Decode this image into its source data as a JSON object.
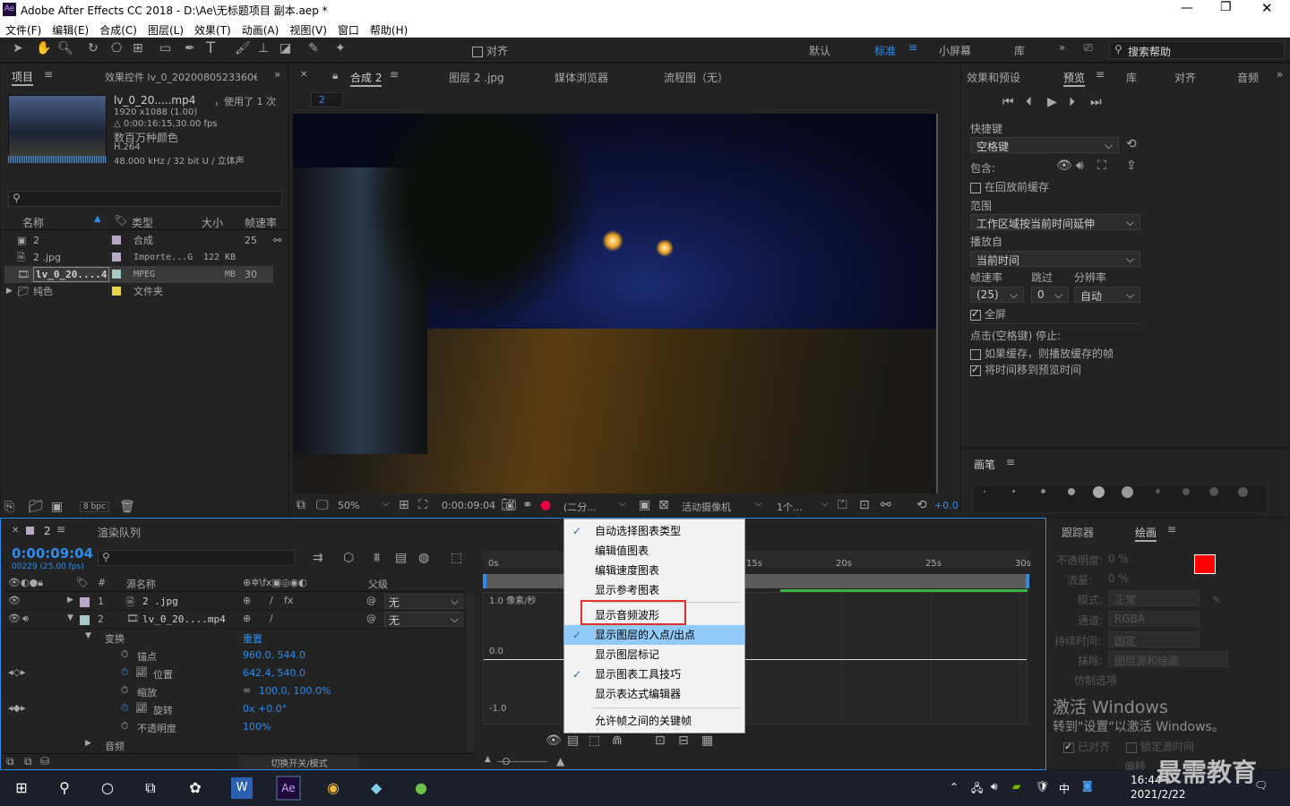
{
  "app": {
    "title": "Adobe After Effects CC 2018 - D:\\Ae\\无标题项目 副本.aep *",
    "logo": "Ae"
  },
  "menus": [
    "文件(F)",
    "编辑(E)",
    "合成(C)",
    "图层(L)",
    "效果(T)",
    "动画(A)",
    "视图(V)",
    "窗口",
    "帮助(H)"
  ],
  "toolbar": {
    "align": "对齐",
    "workspaces": [
      "默认",
      "标准",
      "小屏幕",
      "库"
    ],
    "search": "搜索帮助"
  },
  "project": {
    "tab": "项目",
    "effects_tab": "效果控件 lv_0_2020080523360€",
    "filename": "lv_0_20.....mp4",
    "used": "，使用了 1 次",
    "res": "1920 x1088 (1.00)",
    "dur": "△ 0:00:16:15,30.00 fps",
    "colors": "数百万种颜色",
    "codec": "H.264",
    "audio": "48.000 kHz / 32 bit U / 立体声",
    "cols": [
      "名称",
      "类型",
      "大小",
      "帧速率"
    ],
    "items": [
      {
        "name": "2",
        "type": "合成",
        "size": "",
        "fps": "25",
        "color": "#b9a6c9"
      },
      {
        "name": "2 .jpg",
        "type": "Importe...G",
        "size": "122 KB",
        "fps": "",
        "color": "#b9a6c9"
      },
      {
        "name": "lv_0_20....4",
        "type": "MPEG",
        "size": "MB",
        "fps": "30",
        "color": "#a6c9c9"
      },
      {
        "name": "纯色",
        "type": "文件夹",
        "size": "",
        "fps": "",
        "color": "#e8d44a"
      }
    ],
    "bpc": "8 bpc"
  },
  "viewer": {
    "tab": "合成 2",
    "layer_tab": "图层 2 .jpg",
    "media_tab": "媒体浏览器",
    "flow_tab": "流程图（无）",
    "comp_chip": "2",
    "zoom": "50%",
    "time": "0:00:09:04",
    "res": "(二分...",
    "camera": "活动摄像机",
    "views": "1个...",
    "exposure": "+0.0"
  },
  "preview": {
    "tabs": [
      "效果和预设",
      "预览",
      "库",
      "对齐",
      "音频"
    ],
    "shortcut_label": "快捷键",
    "shortcut": "空格键",
    "include": "包含:",
    "cache": "在回放前缓存",
    "range_label": "范围",
    "range": "工作区域按当前时间延伸",
    "from_label": "播放自",
    "from": "当前时间",
    "fps_label": "帧速率",
    "skip_label": "跳过",
    "res_label": "分辨率",
    "fps": "(25)",
    "skip": "0",
    "res": "自动",
    "fullscreen": "全屏",
    "stop_label": "点击(空格键) 停止:",
    "if_cache": "如果缓存，则播放缓存的帧",
    "move_time": "将时间移到预览时间"
  },
  "brush": {
    "tab": "画笔",
    "sizes": [
      "1",
      "3",
      "5",
      "9",
      "13",
      "19",
      "5",
      "9",
      "13",
      "17"
    ]
  },
  "timeline": {
    "tab": "2",
    "render_tab": "渲染队列",
    "time": "0:00:09:04",
    "frames": "00229 (25.00 fps)",
    "cols": [
      "源名称",
      "父级"
    ],
    "layers": [
      {
        "num": "1",
        "name": "2 .jpg",
        "parent": "无"
      },
      {
        "num": "2",
        "name": "lv_0_20....mp4",
        "parent": "无"
      }
    ],
    "transform": "变换",
    "reset": "重置",
    "props": [
      {
        "name": "锚点",
        "val": "960.0, 544.0"
      },
      {
        "name": "位置",
        "val": "642.4, 540.0"
      },
      {
        "name": "缩放",
        "val": "100.0, 100.0%"
      },
      {
        "name": "旋转",
        "val": "0x +0.0°"
      },
      {
        "name": "不透明度",
        "val": "100%"
      }
    ],
    "audio": "音频",
    "toggle": "切换开关/模式",
    "ruler": [
      "0s",
      "15s",
      "20s",
      "25s",
      "30s"
    ],
    "graph_label": "1.0 像素/秒",
    "graph_mid": "0.0",
    "graph_low": "-1.0"
  },
  "context_menu": {
    "items": [
      {
        "label": "自动选择图表类型",
        "checked": true
      },
      {
        "label": "编辑值图表",
        "checked": false
      },
      {
        "label": "编辑速度图表",
        "checked": false
      },
      {
        "label": "显示参考图表",
        "checked": false
      },
      {
        "label": "显示音频波形",
        "checked": false
      },
      {
        "label": "显示图层的入点/出点",
        "checked": true
      },
      {
        "label": "显示图层标记",
        "checked": false
      },
      {
        "label": "显示图表工具技巧",
        "checked": true
      },
      {
        "label": "显示表达式编辑器",
        "checked": false
      },
      {
        "label": "允许帧之间的关键帧",
        "checked": false
      }
    ]
  },
  "tracker": {
    "tab": "跟踪器",
    "paint_tab": "绘画",
    "opacity": "不透明度:",
    "opacity_val": "0 %",
    "flow": "流量:",
    "flow_val": "0 %",
    "mode": "模式:",
    "mode_val": "正常",
    "channel": "通道:",
    "channel_val": "RGBA",
    "duration": "持续时间:",
    "duration_val": "固定",
    "erase": "抹除:",
    "erase_val": "图层源和绘画",
    "clone": "仿制选项",
    "aligned": "已对齐",
    "lock": "锁定源时间",
    "offset": "偏移"
  },
  "watermark": {
    "line1": "激活 Windows",
    "line2": "转到\"设置\"以激活 Windows。",
    "brand": "最需教育"
  },
  "taskbar": {
    "time": "16:44",
    "date": "2021/2/22",
    "ime": "中"
  }
}
